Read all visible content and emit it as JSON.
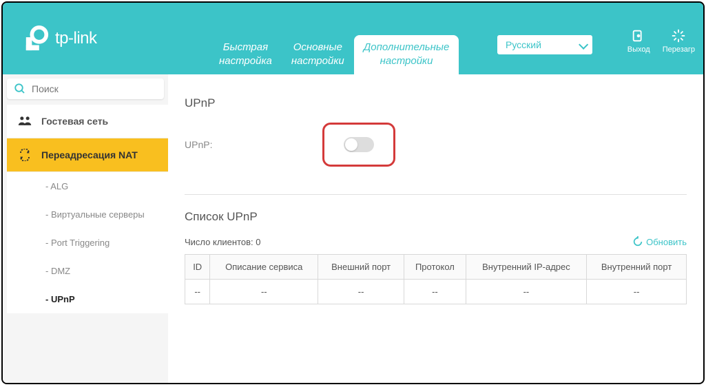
{
  "header": {
    "brand": "tp-link",
    "tabs": [
      {
        "line1": "Быстрая",
        "line2": "настройка"
      },
      {
        "line1": "Основные",
        "line2": "настройки"
      },
      {
        "line1": "Дополнительные",
        "line2": "настройки"
      }
    ],
    "language": "Русский",
    "logout": "Выход",
    "reboot": "Перезагр"
  },
  "sidebar": {
    "search_placeholder": "Поиск",
    "items": [
      {
        "label": "Гостевая сеть"
      },
      {
        "label": "Переадресация NAT"
      }
    ],
    "sub_items": [
      {
        "label": "- ALG"
      },
      {
        "label": "- Виртуальные серверы"
      },
      {
        "label": "- Port Triggering"
      },
      {
        "label": "- DMZ"
      },
      {
        "label": "- UPnP"
      }
    ]
  },
  "content": {
    "section1_title": "UPnP",
    "upnp_label": "UPnP:",
    "section2_title": "Список UPnP",
    "clients_label": "Число клиентов: 0",
    "refresh_label": "Обновить",
    "table": {
      "headers": [
        "ID",
        "Описание сервиса",
        "Внешний порт",
        "Протокол",
        "Внутренний IP-адрес",
        "Внутренний порт"
      ],
      "row": [
        "--",
        "--",
        "--",
        "--",
        "--",
        "--"
      ]
    }
  }
}
